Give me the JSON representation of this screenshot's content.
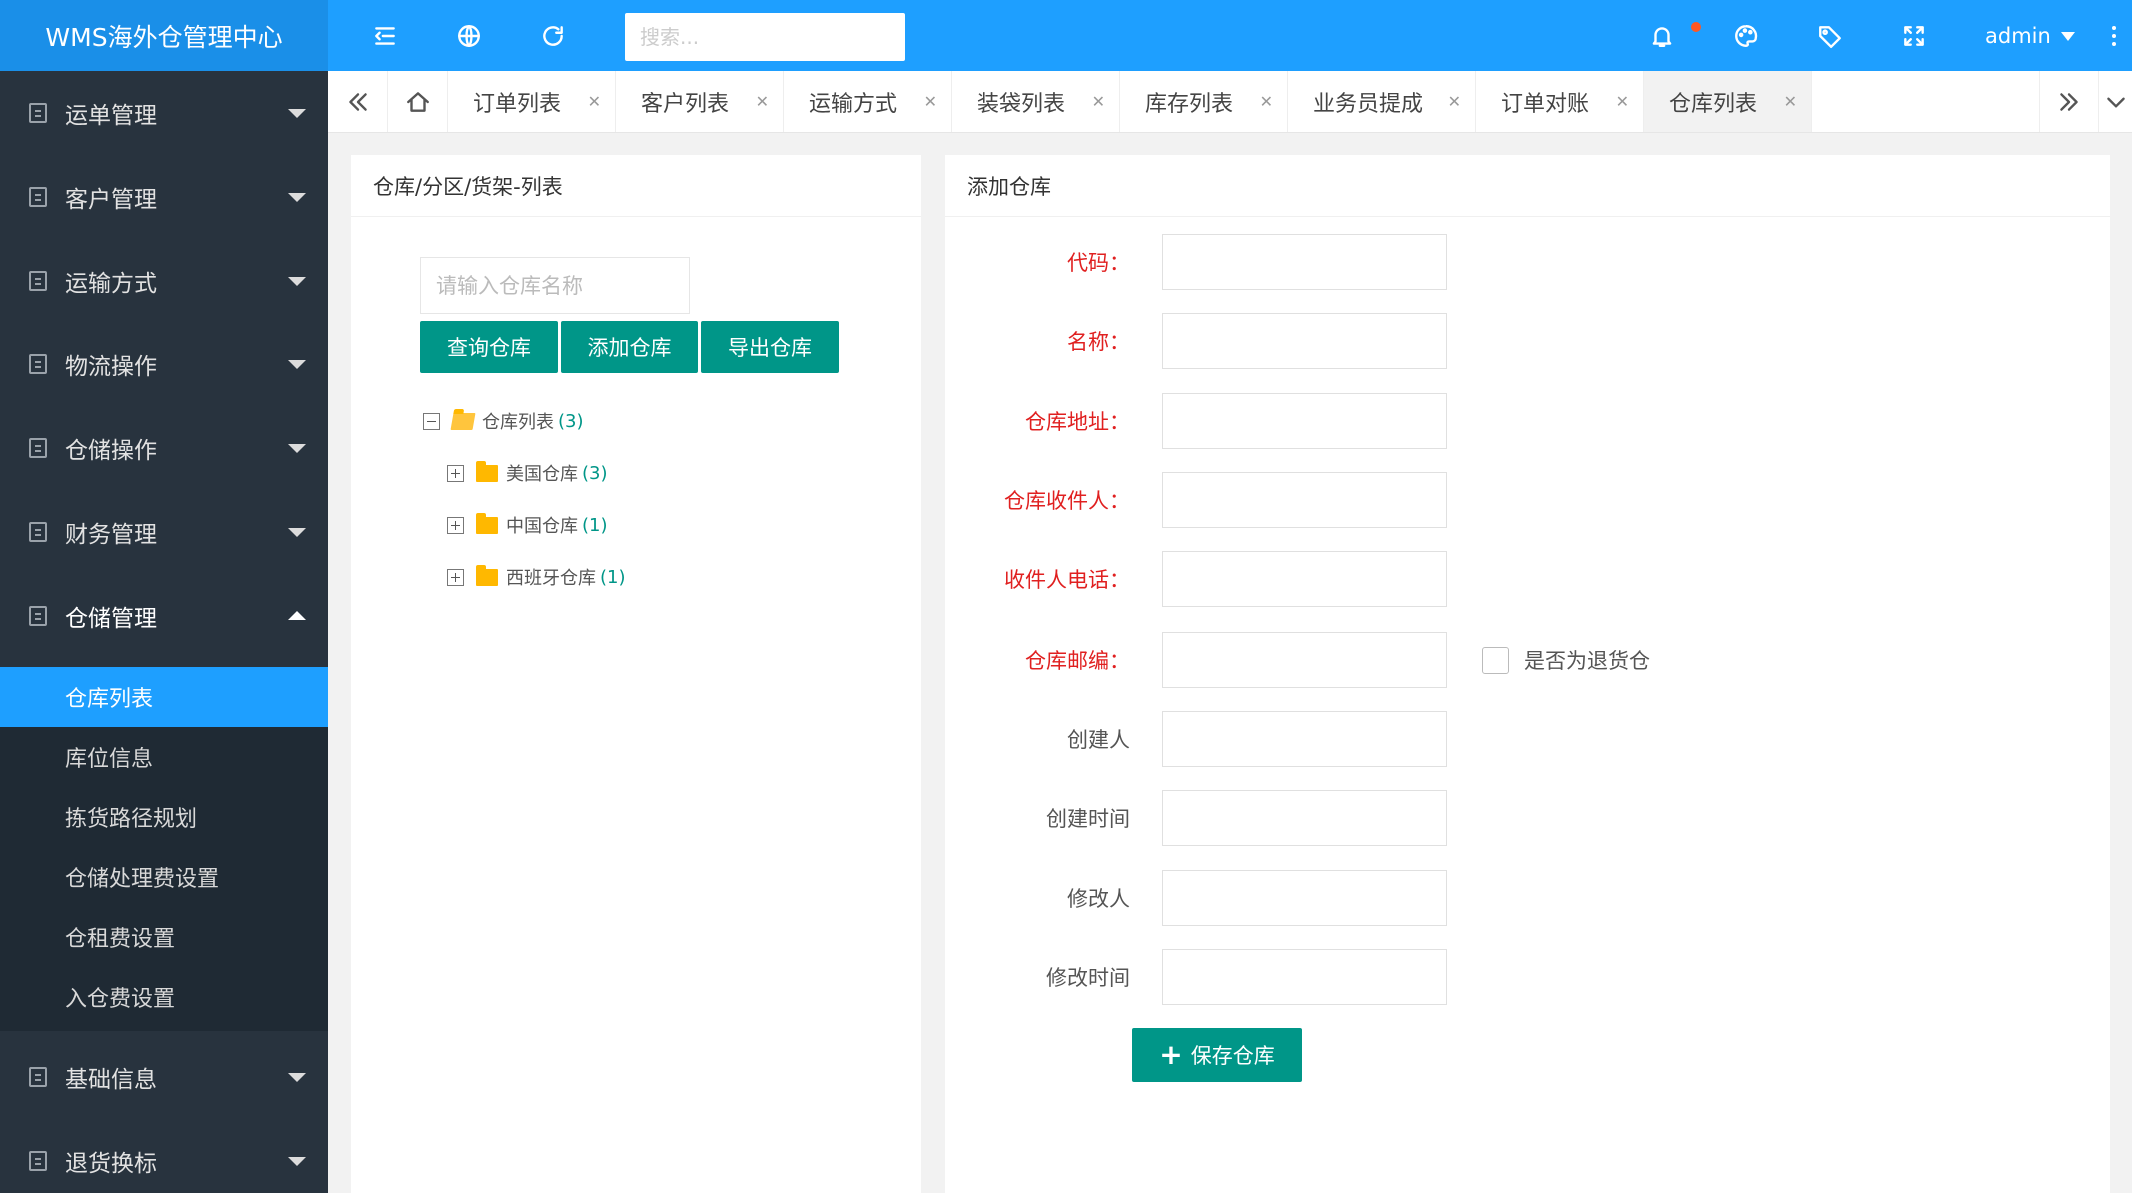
{
  "app": {
    "title": "WMS海外仓管理中心"
  },
  "header": {
    "search_placeholder": "搜索...",
    "user": "admin"
  },
  "sidebar": {
    "menus": [
      {
        "label": "运单管理"
      },
      {
        "label": "客户管理"
      },
      {
        "label": "运输方式"
      },
      {
        "label": "物流操作"
      },
      {
        "label": "仓储操作"
      },
      {
        "label": "财务管理"
      },
      {
        "label": "仓储管理"
      },
      {
        "label": "基础信息"
      },
      {
        "label": "退货换标"
      }
    ],
    "submenu": [
      {
        "label": "仓库列表"
      },
      {
        "label": "库位信息"
      },
      {
        "label": "拣货路径规划"
      },
      {
        "label": "仓储处理费设置"
      },
      {
        "label": "仓租费设置"
      },
      {
        "label": "入仓费设置"
      }
    ]
  },
  "tabs": [
    {
      "label": "订单列表"
    },
    {
      "label": "客户列表"
    },
    {
      "label": "运输方式"
    },
    {
      "label": "装袋列表"
    },
    {
      "label": "库存列表"
    },
    {
      "label": "业务员提成"
    },
    {
      "label": "订单对账"
    },
    {
      "label": "仓库列表"
    }
  ],
  "left_panel": {
    "title": "仓库/分区/货架-列表",
    "search_placeholder": "请输入仓库名称",
    "buttons": {
      "query": "查询仓库",
      "add": "添加仓库",
      "export": "导出仓库"
    },
    "tree": {
      "root": {
        "label": "仓库列表",
        "count": "(3)"
      },
      "children": [
        {
          "label": "美国仓库",
          "count": "(3)"
        },
        {
          "label": "中国仓库",
          "count": "(1)"
        },
        {
          "label": "西班牙仓库",
          "count": "(1)"
        }
      ]
    }
  },
  "right_panel": {
    "title": "添加仓库",
    "fields": {
      "code": "代码：",
      "name": "名称：",
      "address": "仓库地址：",
      "receiver": "仓库收件人：",
      "phone": "收件人电话：",
      "zip": "仓库邮编：",
      "creator": "创建人",
      "created_at": "创建时间",
      "modifier": "修改人",
      "modified_at": "修改时间"
    },
    "return_checkbox": "是否为退货仓",
    "save_button": "保存仓库"
  }
}
